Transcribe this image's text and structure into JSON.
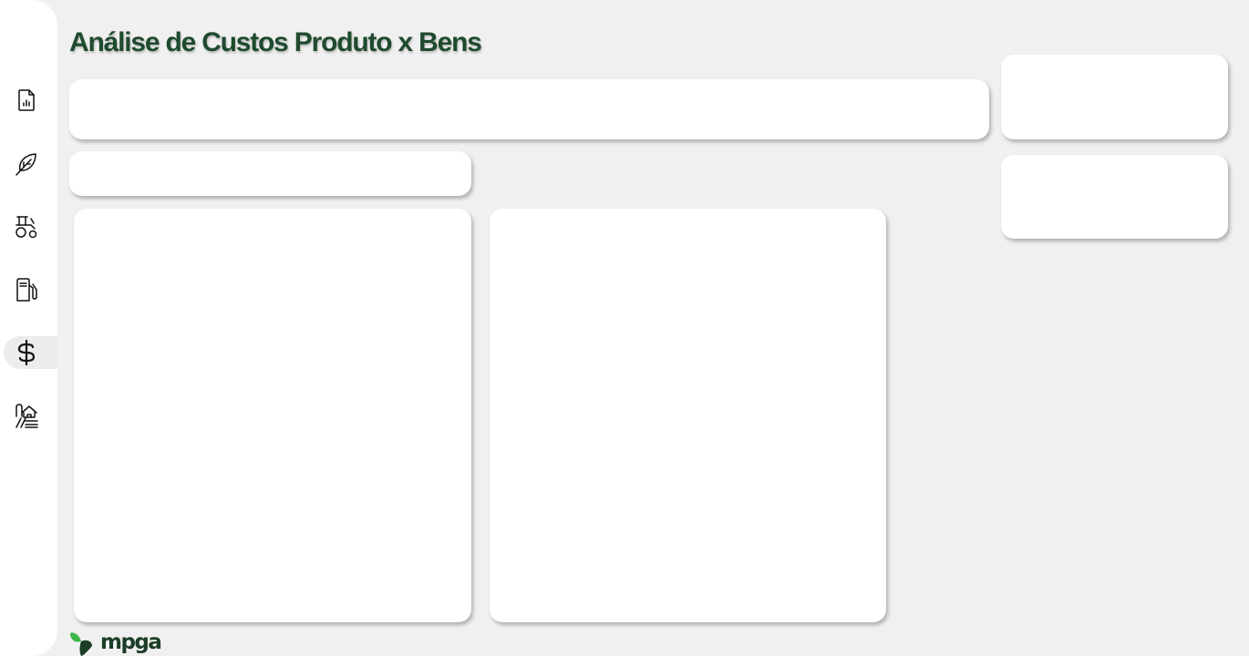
{
  "page": {
    "title": "Análise de Custos Produto x Bens"
  },
  "sidebar": {
    "items": [
      {
        "id": "reports",
        "icon": "report-document-icon",
        "active": false
      },
      {
        "id": "crop",
        "icon": "leaf-icon",
        "active": false
      },
      {
        "id": "machinery",
        "icon": "tractor-icon",
        "active": false
      },
      {
        "id": "fuel",
        "icon": "fuel-pump-icon",
        "active": false
      },
      {
        "id": "costs",
        "icon": "dollar-icon",
        "active": true
      },
      {
        "id": "farm",
        "icon": "farm-house-icon",
        "active": false
      }
    ]
  },
  "footer": {
    "logo_text": "mpga"
  },
  "colors": {
    "title": "#1f4a2e",
    "logo_dark": "#1c3d27",
    "logo_green": "#3bb54a",
    "background": "#f0f0f0",
    "panel": "#ffffff"
  }
}
